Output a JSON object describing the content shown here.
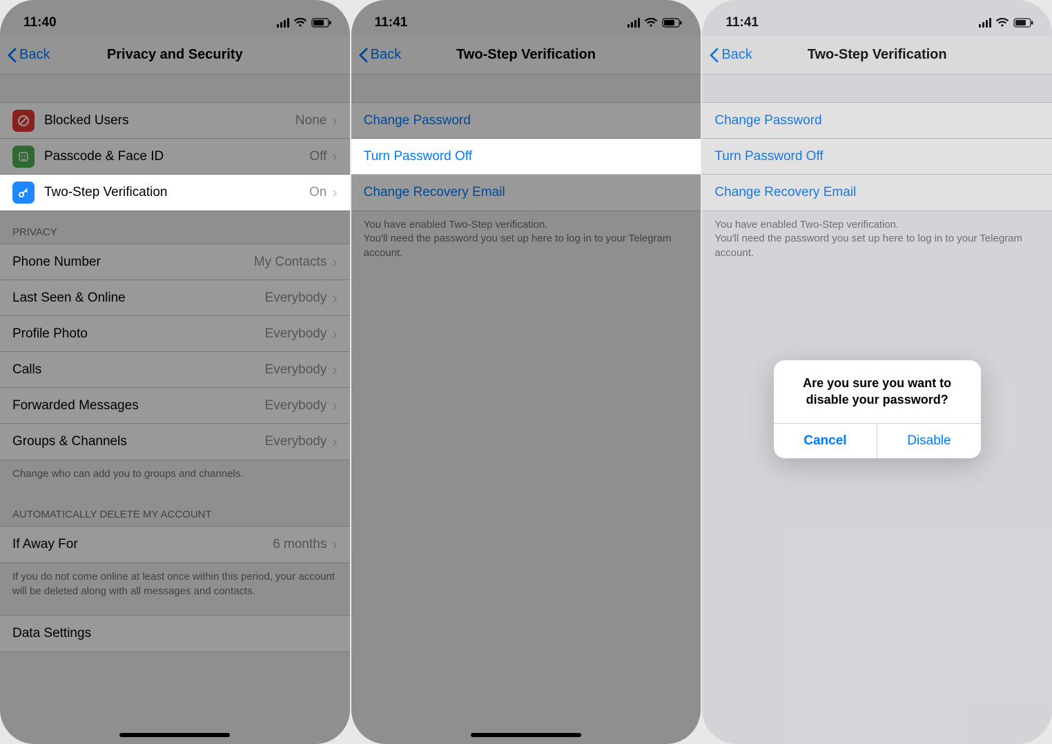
{
  "screen1": {
    "time": "11:40",
    "back": "Back",
    "title": "Privacy and Security",
    "security": [
      {
        "icon": "red",
        "name": "blocked",
        "label": "Blocked Users",
        "value": "None"
      },
      {
        "icon": "green",
        "name": "passcode",
        "label": "Passcode & Face ID",
        "value": "Off"
      },
      {
        "icon": "blue",
        "name": "twostep",
        "label": "Two-Step Verification",
        "value": "On"
      }
    ],
    "privacy_header": "Privacy",
    "privacy": [
      {
        "label": "Phone Number",
        "value": "My Contacts"
      },
      {
        "label": "Last Seen & Online",
        "value": "Everybody"
      },
      {
        "label": "Profile Photo",
        "value": "Everybody"
      },
      {
        "label": "Calls",
        "value": "Everybody"
      },
      {
        "label": "Forwarded Messages",
        "value": "Everybody"
      },
      {
        "label": "Groups & Channels",
        "value": "Everybody"
      }
    ],
    "privacy_footer": "Change who can add you to groups and channels.",
    "delete_header": "Automatically delete my account",
    "delete_row": {
      "label": "If Away For",
      "value": "6 months"
    },
    "delete_footer": "If you do not come online at least once within this period, your account will be deleted along with all messages and contacts.",
    "data_settings": "Data Settings"
  },
  "screen2": {
    "time": "11:41",
    "back": "Back",
    "title": "Two-Step Verification",
    "rows": [
      {
        "label": "Change Password",
        "name": "change-password-row"
      },
      {
        "label": "Turn Password Off",
        "name": "turn-password-off-row"
      },
      {
        "label": "Change Recovery Email",
        "name": "change-recovery-email-row"
      }
    ],
    "footer": "You have enabled Two-Step verification.\nYou'll need the password you set up here to log in to your Telegram account."
  },
  "screen3": {
    "time": "11:41",
    "back": "Back",
    "title": "Two-Step Verification",
    "rows": [
      {
        "label": "Change Password"
      },
      {
        "label": "Turn Password Off"
      },
      {
        "label": "Change Recovery Email"
      }
    ],
    "footer": "You have enabled Two-Step verification.\nYou'll need the password you set up here to log in to your Telegram account.",
    "alert": {
      "message": "Are you sure you want to disable your password?",
      "cancel": "Cancel",
      "confirm": "Disable"
    }
  }
}
